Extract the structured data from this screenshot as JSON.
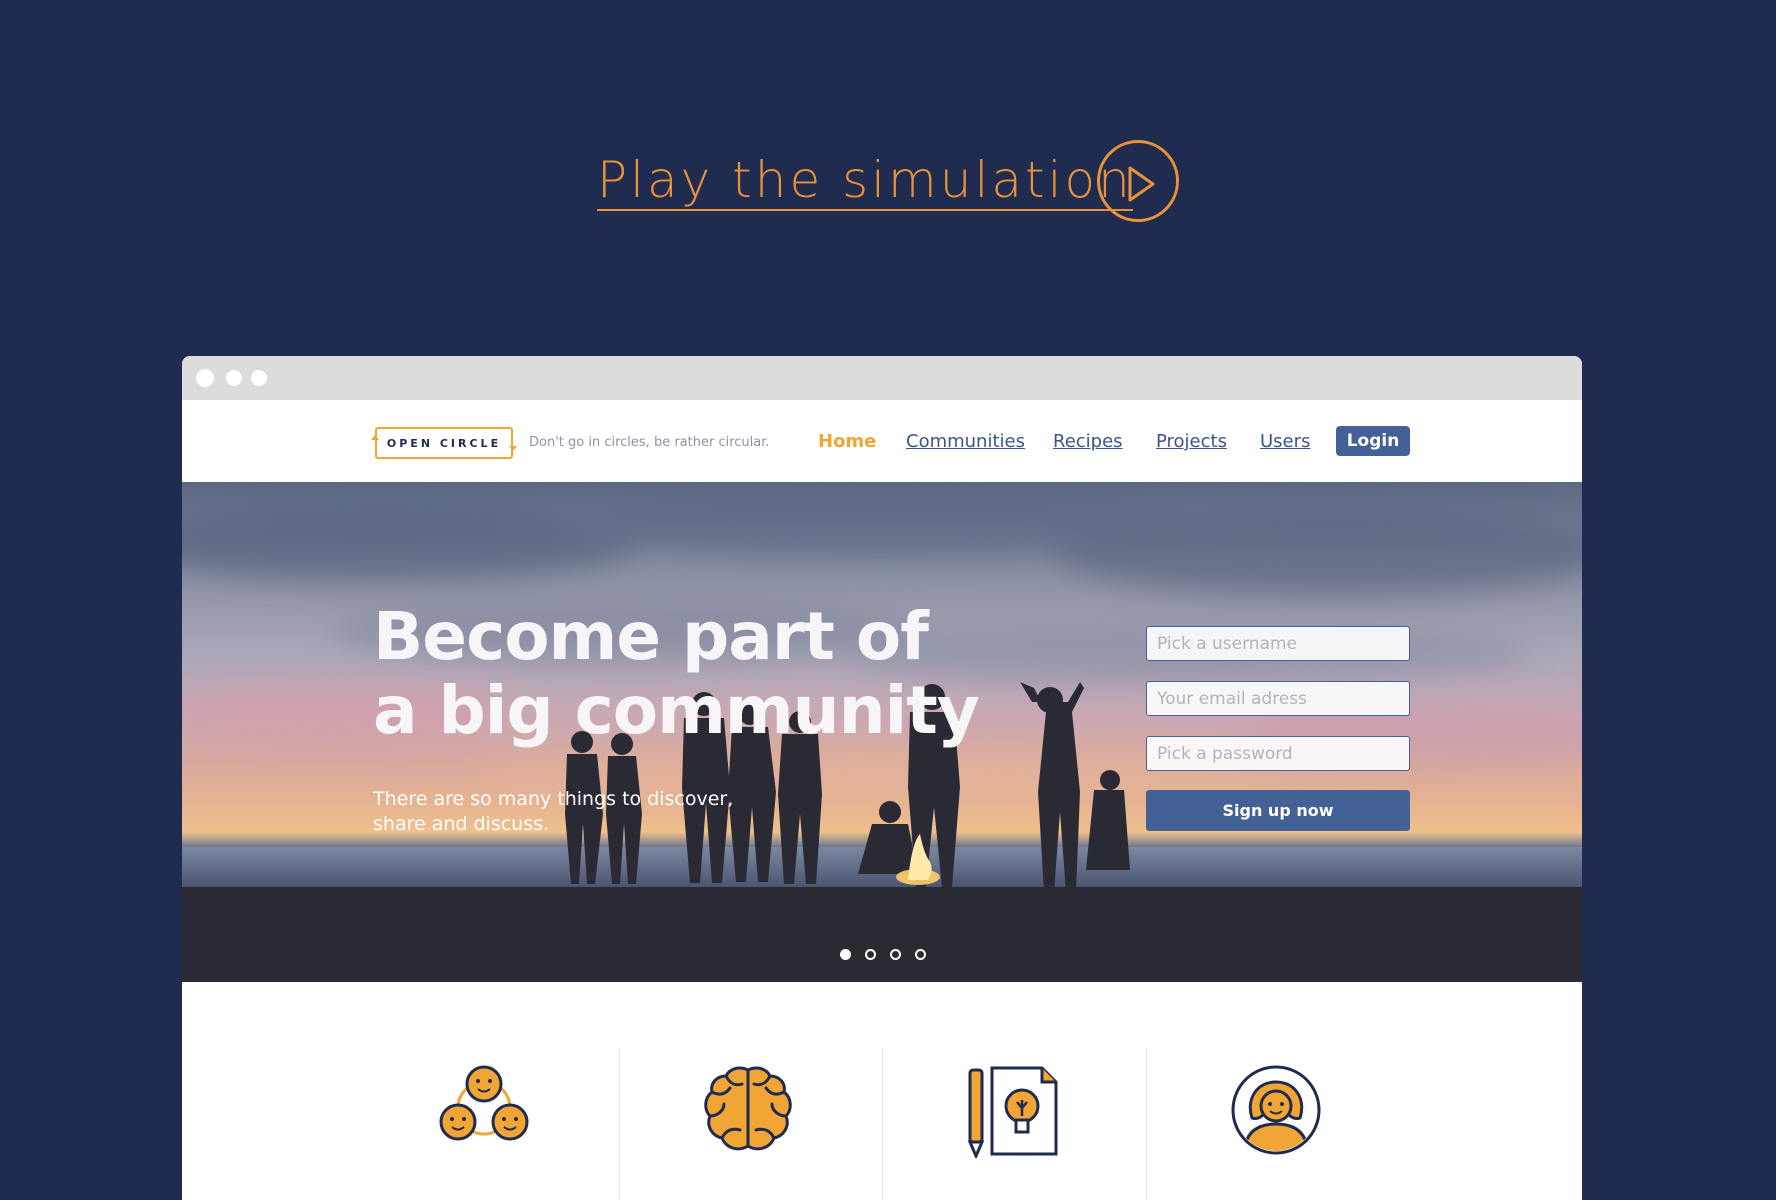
{
  "header": {
    "play_label": "Play the simulation",
    "play_icon": "play-icon"
  },
  "colors": {
    "background": "#1f2b4f",
    "accent_orange": "#e8923a",
    "brand_yellow": "#f0a534",
    "brand_blue": "#436197"
  },
  "site": {
    "logo_text": "OPEN CIRCLE",
    "tagline": "Don't go in circles, be rather circular.",
    "nav": [
      {
        "label": "Home",
        "active": true
      },
      {
        "label": "Communities"
      },
      {
        "label": "Recipes"
      },
      {
        "label": "Projects"
      },
      {
        "label": "Users"
      }
    ],
    "login_label": "Login"
  },
  "hero": {
    "title_line1": "Become part of",
    "title_line2": "a big community",
    "subtitle_line1": "There are so many things to discover,",
    "subtitle_line2": "share and discuss.",
    "form": {
      "username_placeholder": "Pick a username",
      "email_placeholder": "Your email adress",
      "password_placeholder": "Pick a password",
      "signup_label": "Sign up now"
    },
    "carousel": {
      "count": 4,
      "active_index": 0
    }
  },
  "features": {
    "icons": [
      "community-faces-icon",
      "brain-icon",
      "idea-document-icon",
      "user-avatar-icon"
    ]
  }
}
